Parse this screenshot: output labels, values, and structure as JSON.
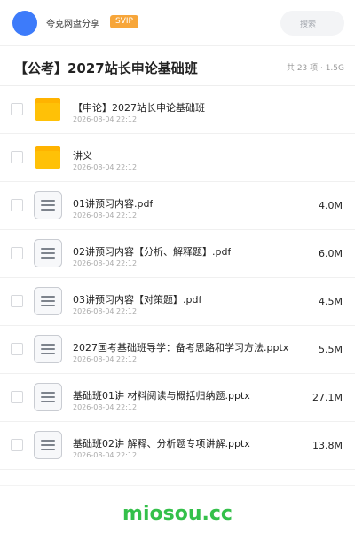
{
  "header": {
    "app_name": "夸克网盘分享",
    "badge": "SVIP",
    "search_placeholder": "搜索",
    "avatar_color": "#3d7bfa",
    "badge_color": "#f7a63a"
  },
  "folder": {
    "title": "【公考】2027站长申论基础班",
    "summary": "共 23 项 · 1.5G"
  },
  "files": [
    {
      "icon": "folder-icon",
      "name": "【申论】2027站长申论基础班",
      "date": "2026-08-04 22:12",
      "size": ""
    },
    {
      "icon": "folder-icon",
      "name": "讲义",
      "date": "2026-08-04 22:12",
      "size": ""
    },
    {
      "icon": "document-icon",
      "name": "01讲预习内容.pdf",
      "date": "2026-08-04 22:12",
      "size": "4.0M"
    },
    {
      "icon": "document-icon",
      "name": "02讲预习内容【分析、解释题】.pdf",
      "date": "2026-08-04 22:12",
      "size": "6.0M"
    },
    {
      "icon": "document-icon",
      "name": "03讲预习内容【对策题】.pdf",
      "date": "2026-08-04 22:12",
      "size": "4.5M"
    },
    {
      "icon": "document-icon",
      "name": "2027国考基础班导学：备考思路和学习方法.pptx",
      "date": "2026-08-04 22:12",
      "size": "5.5M"
    },
    {
      "icon": "document-icon",
      "name": "基础班01讲 材料阅读与概括归纳题.pptx",
      "date": "2026-08-04 22:12",
      "size": "27.1M"
    },
    {
      "icon": "document-icon",
      "name": "基础班02讲 解释、分析题专项讲解.pptx",
      "date": "2026-08-04 22:12",
      "size": "13.8M"
    }
  ],
  "watermark": "miosou.cc",
  "colors": {
    "folder": "#ffc107",
    "folder_tab": "#ffb300",
    "doc_border": "#c9ccd2",
    "doc_line": "#7d838c",
    "watermark": "#34c04a"
  }
}
